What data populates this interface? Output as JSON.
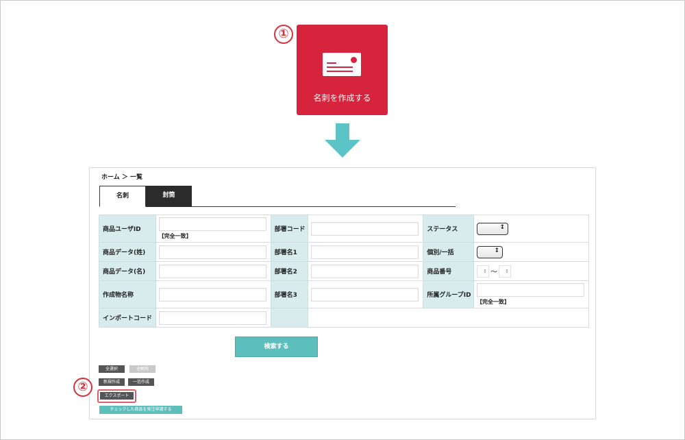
{
  "steps": {
    "one": "①",
    "two": "②"
  },
  "card_button": {
    "label": "名刺を作成する",
    "icon": "business-card-icon",
    "color": "#d7243d"
  },
  "arrow": {
    "icon": "arrow-down-icon",
    "color": "#5cc3c7"
  },
  "breadcrumb": "ホーム ＞ 一覧",
  "tabs": [
    {
      "label": "名刺"
    },
    {
      "label": "封筒"
    }
  ],
  "form": {
    "product_user_id": "商品ユーザID",
    "exact_match": "【完全一致】",
    "dept_code": "部署コード",
    "status": "ステータス",
    "product_data_last": "商品データ(姓)",
    "dept_name1": "部署名1",
    "individual_bulk": "個別/一括",
    "product_data_first": "商品データ(名)",
    "dept_name2": "部署名2",
    "product_number": "商品番号",
    "tilde": "〜",
    "creation_name": "作成物名称",
    "dept_name3": "部署名3",
    "group_id": "所属グループID",
    "import_code": "インポートコード"
  },
  "search_button": "検索する",
  "actions": {
    "select_all": "全選択",
    "deselect_all": "全解除",
    "new": "新規作成",
    "bulk_create": "一括作成",
    "export": "エクスポート",
    "request_checked": "チェックした商品を発注申請する"
  },
  "colors": {
    "accent_red": "#d7243d",
    "teal": "#5dbfbb",
    "label_bg": "#d8ecee"
  }
}
